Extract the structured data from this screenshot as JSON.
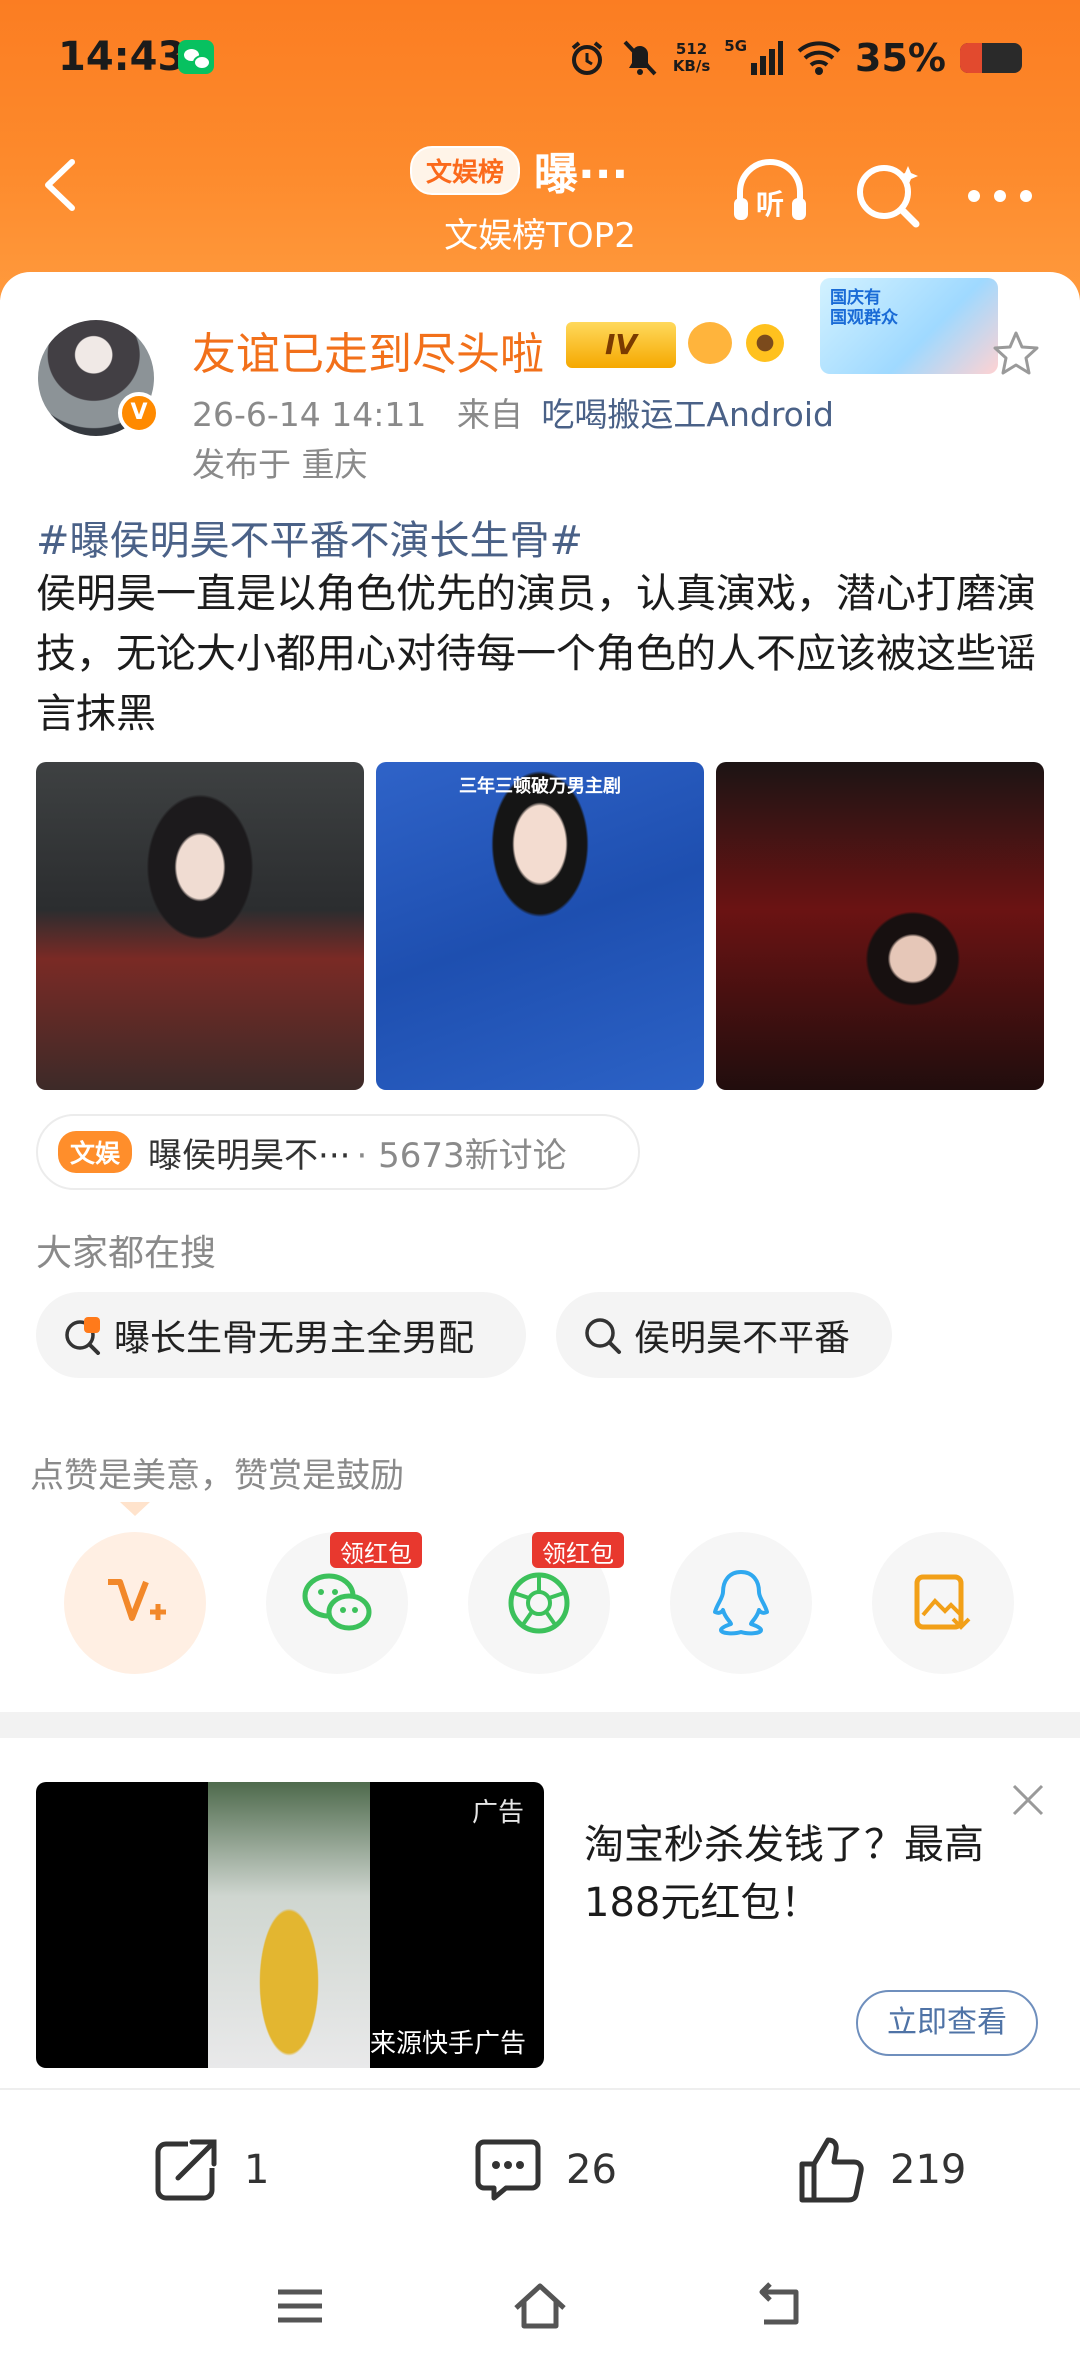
{
  "status_bar": {
    "time": "14:43",
    "net_speed_value": "512",
    "net_speed_unit": "KB/s",
    "network_type": "5G",
    "battery_percent": "35%",
    "battery_level": 0.35,
    "battery_color": "#e24a2e"
  },
  "nav": {
    "tag": "文娱榜",
    "title": "曝···",
    "subtitle": "文娱榜TOP2",
    "icons": [
      "back-icon",
      "listen-icon",
      "search-icon",
      "more-icon"
    ]
  },
  "post": {
    "author": "友谊已走到尽头啦",
    "level": "IV",
    "verify_mark": "V",
    "meta_date": "26-6-14 14:11",
    "meta_from": "来自",
    "meta_source": "吃喝搬运工Android",
    "location": "发布于 重庆",
    "promo_text": "国庆有\n国观群众",
    "hashtag": "#曝侯明昊不平番不演长生骨#",
    "body": " 侯明昊一直是以角色优先的演员，认真演戏，潜心打磨演技，无论大小都用心对待每一个角色的人不应该被这些谣言抹黑",
    "photo2_text": "三年三顿破万男主剧"
  },
  "topic": {
    "tag": "文娱",
    "text": "曝侯明昊不···",
    "count": "· 5673新讨论"
  },
  "search": {
    "heading": "大家都在搜",
    "chips": [
      {
        "label": "曝长生骨无男主全男配",
        "icon": "hot-search-icon"
      },
      {
        "label": "侯明昊不平番",
        "icon": "search-icon"
      }
    ]
  },
  "share": {
    "label": "点赞是美意，赞赏是鼓励",
    "hongbao": "领红包",
    "buttons": [
      "reward-icon",
      "wechat-icon",
      "moments-icon",
      "qq-icon",
      "save-image-icon"
    ]
  },
  "ad": {
    "badge": "广告",
    "source": "来源快手广告",
    "title": "淘宝秒杀发钱了？最高188元红包！",
    "cta": "立即查看"
  },
  "actions": {
    "reposts": "1",
    "comments": "26",
    "likes": "219"
  },
  "colors": {
    "brand_orange": "#fb7d22",
    "name_orange": "#f2701a",
    "link_blue": "#4a6187"
  }
}
